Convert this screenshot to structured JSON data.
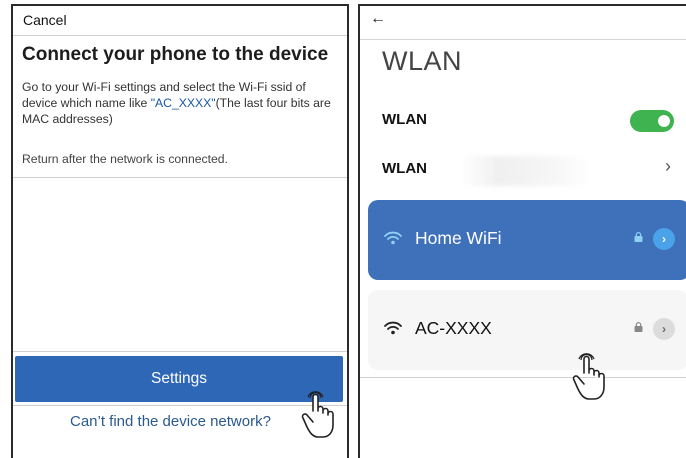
{
  "left_screen": {
    "cancel_label": "Cancel",
    "title": "Connect your phone to the device",
    "instructions_before": "Go to your Wi-Fi settings and select the Wi-Fi ssid of device which name like ",
    "instructions_ssid": "\"AC_XXXX\"",
    "instructions_after": "(The last four bits are MAC addresses)",
    "return_note": "Return after the network is connected.",
    "settings_button": "Settings",
    "cant_find_link": "Can’t find the device network?"
  },
  "right_screen": {
    "back_icon": "arrow-left-icon",
    "title": "WLAN",
    "wlan_toggle_label": "WLAN",
    "wlan_toggle_on": true,
    "wlan_nav_label": "WLAN",
    "networks": [
      {
        "name": "Home WiFi",
        "selected": true,
        "locked": true
      },
      {
        "name": "AC-XXXX",
        "selected": false,
        "locked": true
      }
    ]
  },
  "colors": {
    "primary_blue": "#2f67b7",
    "selected_card": "#3f71bb",
    "toggle_green": "#3fb34f",
    "link_blue": "#2a5a8c"
  }
}
